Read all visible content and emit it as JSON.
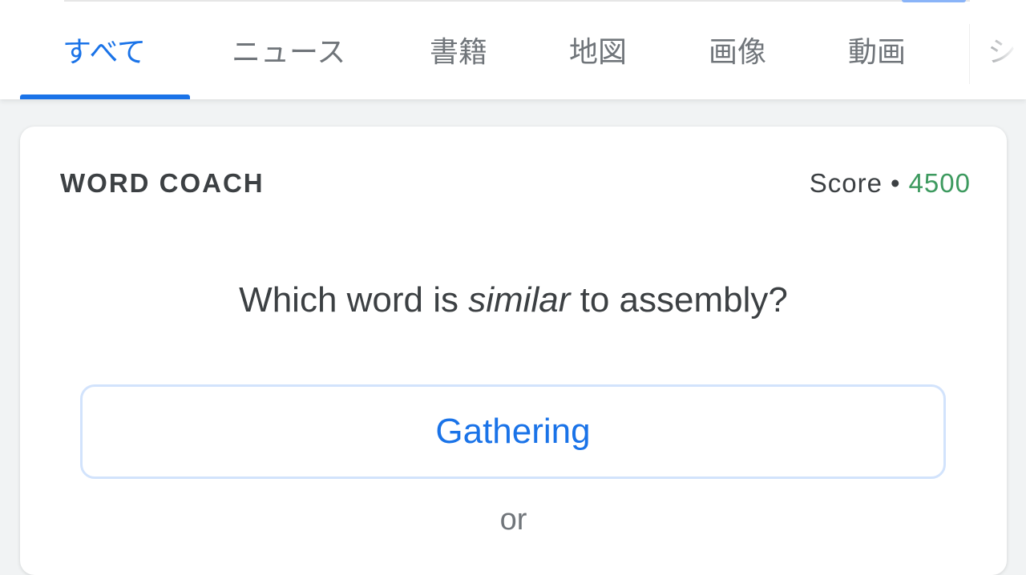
{
  "tabs": [
    {
      "label": "すべて",
      "active": true
    },
    {
      "label": "ニュース"
    },
    {
      "label": "書籍"
    },
    {
      "label": "地図"
    },
    {
      "label": "画像"
    },
    {
      "label": "動画"
    },
    {
      "label": "シ"
    }
  ],
  "word_coach": {
    "title": "WORD COACH",
    "score_label": "Score",
    "score_separator": "•",
    "score_value": "4500",
    "question_prefix": "Which word is",
    "question_emphasis": "similar",
    "question_suffix": "to assembly?",
    "option_1": "Gathering",
    "or_label": "or"
  },
  "colors": {
    "accent": "#1a73e8",
    "score_green": "#3d9a5f",
    "text": "#3c4043",
    "muted": "#70757a"
  }
}
